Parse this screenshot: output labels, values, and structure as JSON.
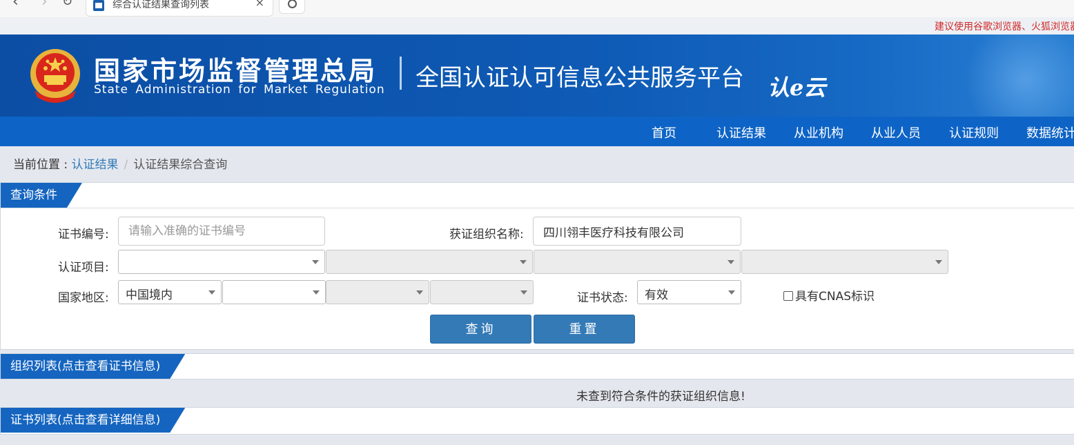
{
  "browser": {
    "tab_title": "综合认证结果查询列表",
    "close_glyph": "×"
  },
  "notice": "建议使用谷歌浏览器、火狐浏览器",
  "header": {
    "agency_cn": "国家市场监督管理总局",
    "agency_en": "State Administration  for  Market Regulation",
    "platform": "全国认证认可信息公共服务平台",
    "logo_text": "认e云"
  },
  "nav": {
    "items": [
      "首页",
      "认证结果",
      "从业机构",
      "从业人员",
      "认证规则",
      "数据统计"
    ]
  },
  "breadcrumb": {
    "lead": "当前位置 : ",
    "link": "认证结果",
    "separator": "/",
    "current": "认证结果综合查询"
  },
  "query": {
    "title": "查询条件",
    "cert_no_label": "证书编号:",
    "cert_no_placeholder": "请输入准确的证书编号",
    "cert_no_value": "",
    "org_name_label": "获证组织名称:",
    "org_name_value": "四川翎丰医疗科技有限公司",
    "project_label": "认证项目:",
    "project_values": [
      "",
      "",
      "",
      ""
    ],
    "region_label": "国家地区:",
    "region_values": [
      "中国境内",
      "",
      "",
      ""
    ],
    "status_label": "证书状态:",
    "status_value": "有效",
    "cnas_label": "具有CNAS标识",
    "search_button": "查询",
    "reset_button": "重置"
  },
  "org_list": {
    "title": "组织列表(点击查看证书信息)",
    "empty_message": "未查到符合条件的获证组织信息!"
  },
  "cert_list": {
    "title": "证书列表(点击查看详细信息)"
  },
  "colors": {
    "banner_blue": "#0c4ea4",
    "nav_blue": "#0e64c6",
    "panel_title_blue": "#1565c0",
    "button_blue": "#337ab7",
    "notice_red": "#d12a2a"
  }
}
